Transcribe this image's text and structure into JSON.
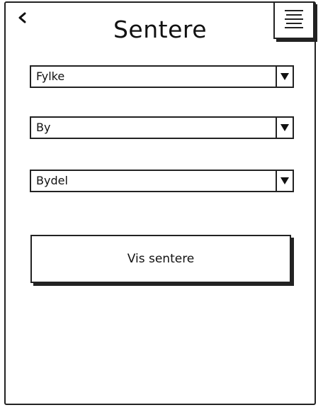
{
  "header": {
    "title": "Sentere",
    "back_icon": "chevron-left-icon",
    "menu_icon": "hamburger-menu-icon"
  },
  "filters": {
    "county": {
      "selected": "Fylke"
    },
    "city": {
      "selected": "By"
    },
    "district": {
      "selected": "Bydel"
    }
  },
  "actions": {
    "show_centers_label": "Vis sentere"
  },
  "colors": {
    "stroke": "#222222",
    "background": "#ffffff"
  }
}
